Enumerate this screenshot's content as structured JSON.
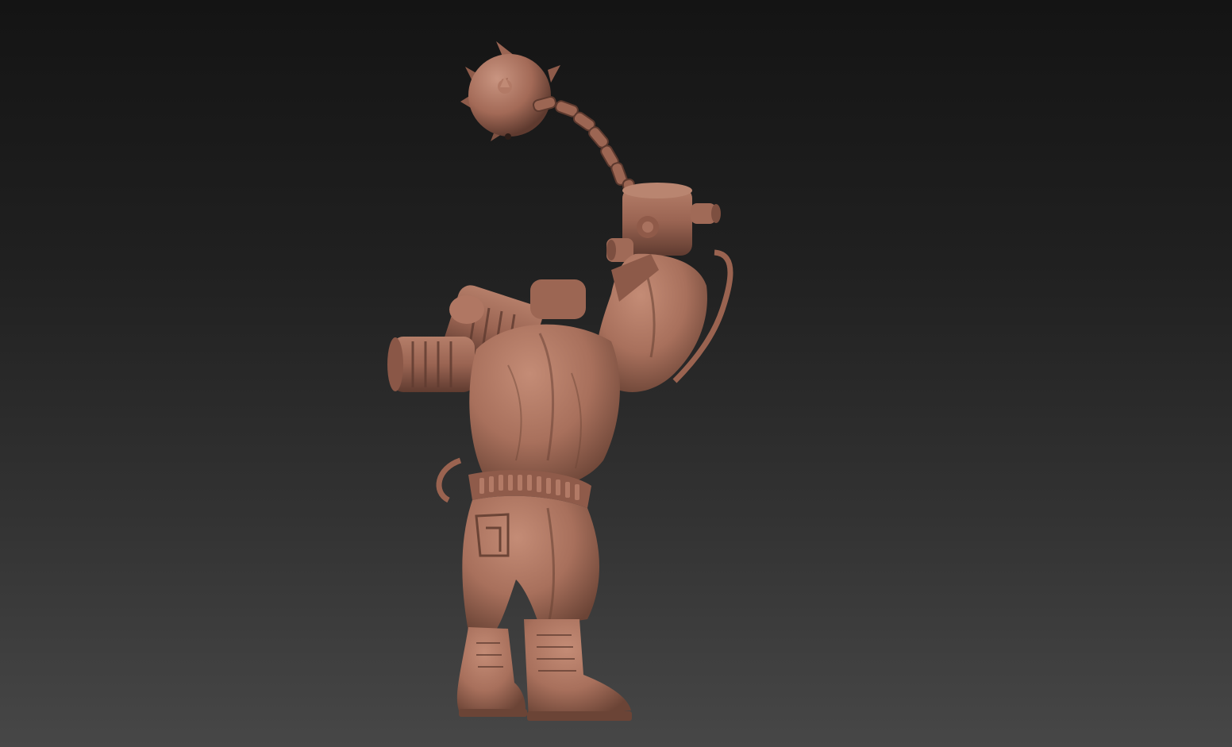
{
  "viewport": {
    "background_top": "#141414",
    "background_bottom": "#474747"
  },
  "model": {
    "subject": "sculpt-figure-with-flail",
    "clay_color": "#a8705c",
    "clay_shadow": "#6b4436",
    "clay_highlight": "#c48c76"
  }
}
